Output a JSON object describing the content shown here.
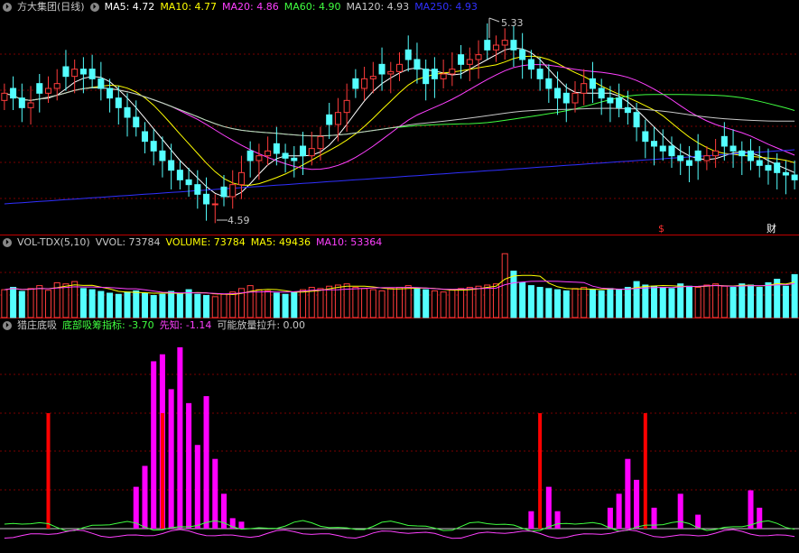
{
  "colors": {
    "up": "#ff3c3c",
    "down": "#54ffff",
    "grid": "#7a0000",
    "ma5": "#ffffff",
    "ma10": "#ffff00",
    "ma20": "#ff40ff",
    "ma60": "#40ff40",
    "ma120": "#c8c8c8",
    "ma250": "#3030ff",
    "bottom": "#40ff40",
    "xianzhi": "#ff40ff",
    "signal": "#ff0000",
    "fund": "#ff00ff"
  },
  "panel_main": {
    "name": "方大集团",
    "period": "(日线)",
    "legend": [
      {
        "label": "MA5: 4.72",
        "color": "#ffffff"
      },
      {
        "label": "MA10: 4.77",
        "color": "#ffff00"
      },
      {
        "label": "MA20: 4.86",
        "color": "#ff40ff"
      },
      {
        "label": "MA60: 4.90",
        "color": "#40ff40"
      },
      {
        "label": "MA120: 4.93",
        "color": "#c8c8c8"
      },
      {
        "label": "MA250: 4.93",
        "color": "#3030ff"
      }
    ],
    "high_label": "5.33",
    "low_label": "4.59",
    "marker_dividend": "$",
    "marker_report": "财"
  },
  "panel_vol": {
    "legend": [
      {
        "label": "VOL-TDX(5,10)",
        "color": "#c8c8c8"
      },
      {
        "label": "VVOL: 73784",
        "color": "#c8c8c8"
      },
      {
        "label": "VOLUME: 73784",
        "color": "#ffff00"
      },
      {
        "label": "MA5: 49436",
        "color": "#ffff00"
      },
      {
        "label": "MA10: 53364",
        "color": "#ff40ff"
      }
    ]
  },
  "panel_ind": {
    "legend": [
      {
        "label": "猎庄底吸",
        "color": "#c8c8c8"
      },
      {
        "label": "底部吸筹指标: -3.70",
        "color": "#40ff40"
      },
      {
        "label": "先知: -1.14",
        "color": "#ff40ff"
      },
      {
        "label": "可能放量拉升: 0.00",
        "color": "#c8c8c8"
      }
    ]
  },
  "chart_data": [
    {
      "type": "candlestick",
      "title": "方大集团 (日线)",
      "series": [
        {
          "name": "MA5",
          "value": 4.72
        },
        {
          "name": "MA10",
          "value": 4.77
        },
        {
          "name": "MA20",
          "value": 4.86
        },
        {
          "name": "MA60",
          "value": 4.9
        },
        {
          "name": "MA120",
          "value": 4.93
        },
        {
          "name": "MA250",
          "value": 4.93
        }
      ],
      "annotations": {
        "high": 5.33,
        "low": 4.59
      },
      "ylim": [
        4.5,
        5.4
      ],
      "close": [
        5.08,
        5.06,
        5.02,
        5.04,
        5.08,
        5.1,
        5.12,
        5.15,
        5.18,
        5.16,
        5.14,
        5.1,
        5.06,
        5.02,
        4.98,
        4.94,
        4.88,
        4.84,
        4.8,
        4.76,
        4.72,
        4.7,
        4.66,
        4.62,
        4.62,
        4.65,
        4.7,
        4.75,
        4.8,
        4.82,
        4.84,
        4.83,
        4.81,
        4.8,
        4.82,
        4.85,
        4.9,
        4.95,
        5.0,
        5.05,
        5.1,
        5.14,
        5.15,
        5.16,
        5.17,
        5.2,
        5.22,
        5.18,
        5.12,
        5.14,
        5.16,
        5.18,
        5.2,
        5.22,
        5.24,
        5.26,
        5.28,
        5.3,
        5.26,
        5.22,
        5.18,
        5.14,
        5.1,
        5.06,
        5.04,
        5.08,
        5.12,
        5.1,
        5.06,
        5.04,
        5.02,
        5.0,
        4.94,
        4.88,
        4.86,
        4.84,
        4.82,
        4.8,
        4.78,
        4.8,
        4.82,
        4.84,
        4.86,
        4.84,
        4.82,
        4.8,
        4.78,
        4.76,
        4.75,
        4.74,
        4.72
      ],
      "volume": [
        48,
        52,
        45,
        50,
        55,
        47,
        60,
        58,
        62,
        50,
        48,
        45,
        42,
        40,
        44,
        46,
        42,
        38,
        40,
        45,
        42,
        48,
        40,
        38,
        36,
        40,
        44,
        50,
        55,
        48,
        46,
        42,
        40,
        44,
        48,
        52,
        50,
        54,
        56,
        58,
        52,
        50,
        48,
        46,
        50,
        52,
        55,
        50,
        48,
        46,
        44,
        48,
        50,
        52,
        54,
        56,
        58,
        110,
        80,
        60,
        55,
        52,
        50,
        48,
        46,
        50,
        52,
        48,
        46,
        50,
        48,
        52,
        62,
        56,
        54,
        52,
        50,
        58,
        54,
        52,
        56,
        58,
        54,
        52,
        58,
        56,
        52,
        60,
        66,
        54,
        74
      ],
      "volume_ma5": 49436,
      "volume_ma10": 53364,
      "volume_latest": 73784
    },
    {
      "type": "bar",
      "title": "猎庄底吸",
      "series": [
        {
          "name": "底部吸筹指标",
          "value": -3.7
        },
        {
          "name": "先知",
          "value": -1.14
        },
        {
          "name": "可能放量拉升",
          "value": 0.0
        }
      ],
      "signal_bars": [
        5,
        18,
        61,
        73
      ],
      "fund_bars": [
        {
          "i": 15,
          "v": 12
        },
        {
          "i": 16,
          "v": 18
        },
        {
          "i": 17,
          "v": 48
        },
        {
          "i": 18,
          "v": 50
        },
        {
          "i": 19,
          "v": 40
        },
        {
          "i": 20,
          "v": 52
        },
        {
          "i": 21,
          "v": 36
        },
        {
          "i": 22,
          "v": 24
        },
        {
          "i": 23,
          "v": 38
        },
        {
          "i": 24,
          "v": 20
        },
        {
          "i": 25,
          "v": 10
        },
        {
          "i": 26,
          "v": 3
        },
        {
          "i": 27,
          "v": 2
        },
        {
          "i": 60,
          "v": 5
        },
        {
          "i": 62,
          "v": 12
        },
        {
          "i": 63,
          "v": 5
        },
        {
          "i": 69,
          "v": 6
        },
        {
          "i": 70,
          "v": 10
        },
        {
          "i": 71,
          "v": 20
        },
        {
          "i": 72,
          "v": 14
        },
        {
          "i": 74,
          "v": 6
        },
        {
          "i": 77,
          "v": 10
        },
        {
          "i": 79,
          "v": 4
        },
        {
          "i": 85,
          "v": 11
        },
        {
          "i": 86,
          "v": 6
        }
      ]
    }
  ]
}
